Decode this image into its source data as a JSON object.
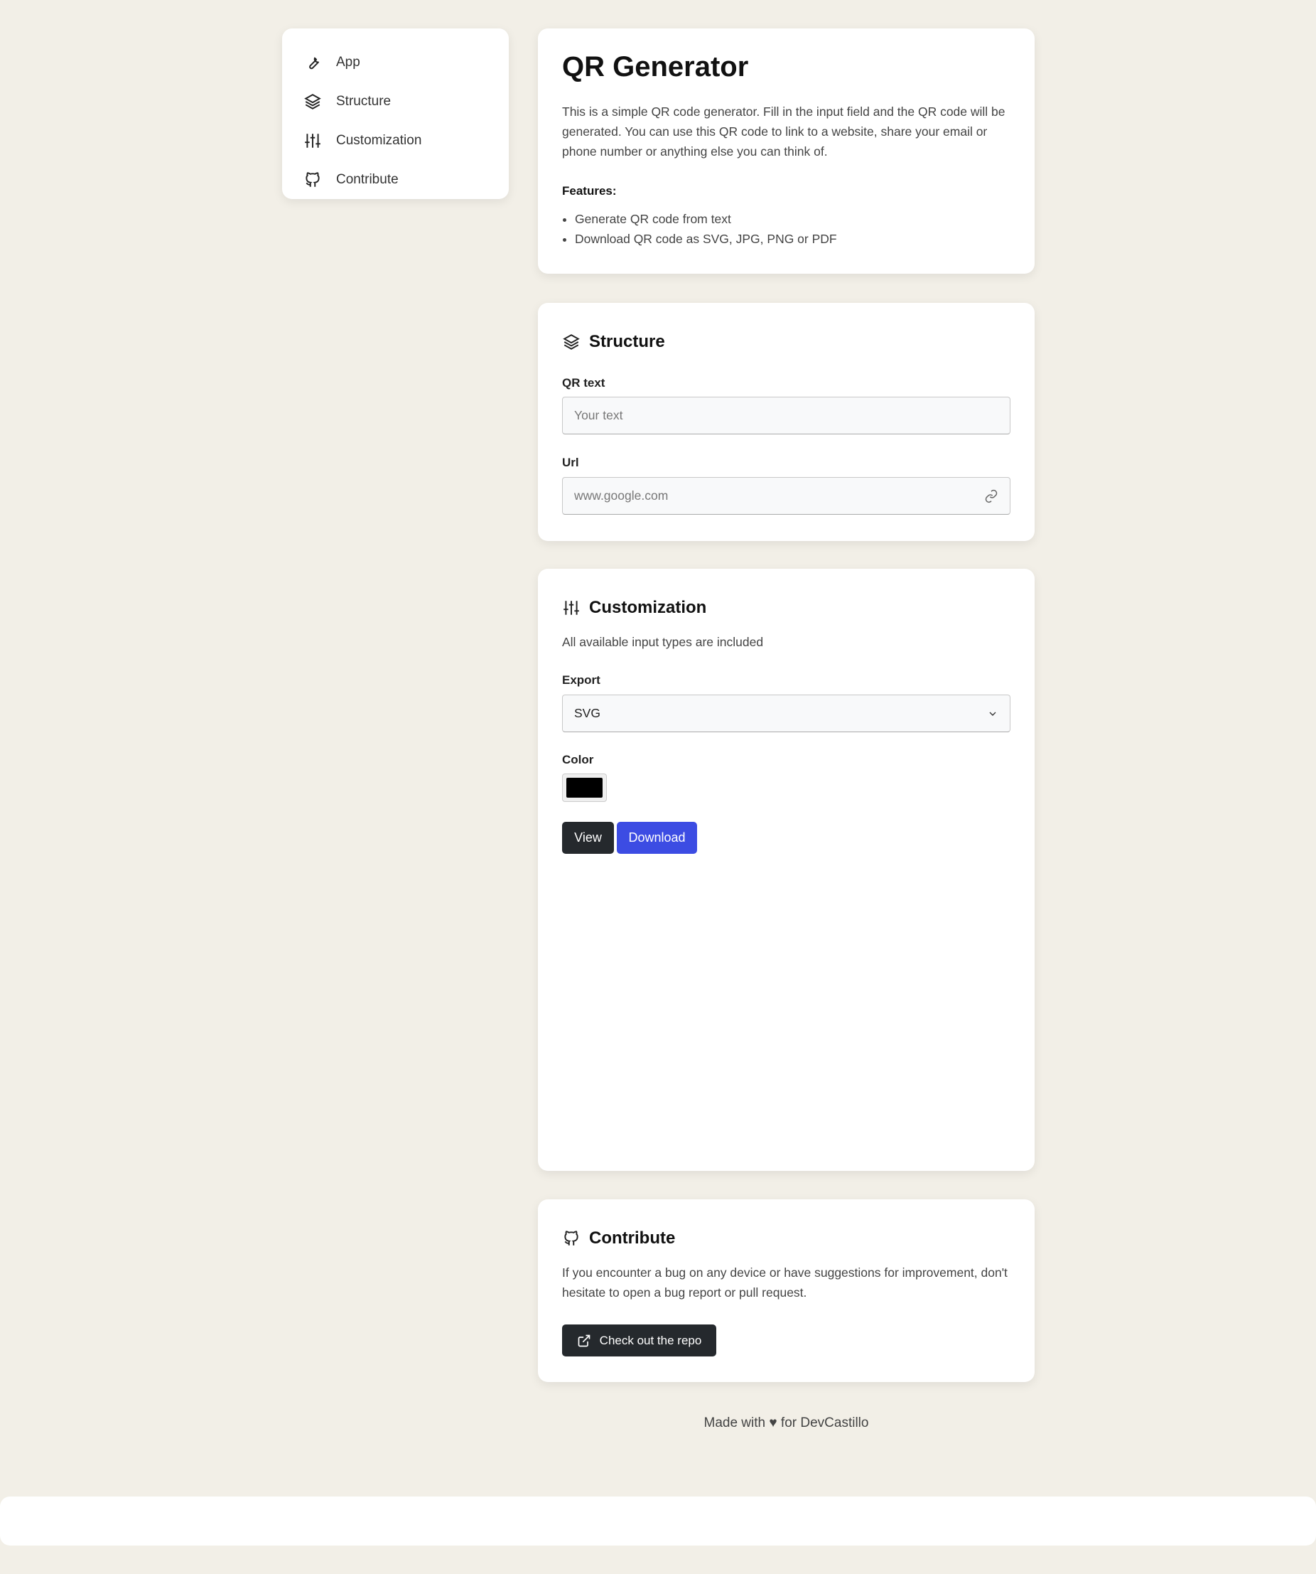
{
  "sidebar": {
    "items": [
      {
        "label": "App",
        "icon": "wrench-icon"
      },
      {
        "label": "Structure",
        "icon": "layers-icon"
      },
      {
        "label": "Customization",
        "icon": "sliders-icon"
      },
      {
        "label": "Contribute",
        "icon": "github-icon"
      }
    ]
  },
  "intro": {
    "title": "QR Generator",
    "description": "This is a simple QR code generator. Fill in the input field and the QR code will be generated. You can use this QR code to link to a website, share your email or phone number or anything else you can think of.",
    "features_label": "Features:",
    "features": [
      "Generate QR code from text",
      "Download QR code as SVG, JPG, PNG or PDF"
    ]
  },
  "structure": {
    "title": "Structure",
    "qr_label": "QR text",
    "qr_placeholder": "Your text",
    "url_label": "Url",
    "url_placeholder": "www.google.com"
  },
  "customization": {
    "title": "Customization",
    "description": "All available input types are included",
    "export_label": "Export",
    "export_value": "SVG",
    "color_label": "Color",
    "color_value": "#000000",
    "view_label": "View",
    "download_label": "Download",
    "view_color": "#25292d",
    "download_color": "#3c4ce3"
  },
  "contribute": {
    "title": "Contribute",
    "description": "If you encounter a bug on any device or have suggestions for improvement, don't hesitate to open a bug report or pull request.",
    "button_label": "Check out the repo"
  },
  "footer": {
    "text": "Made with ♥ for DevCastillo"
  }
}
